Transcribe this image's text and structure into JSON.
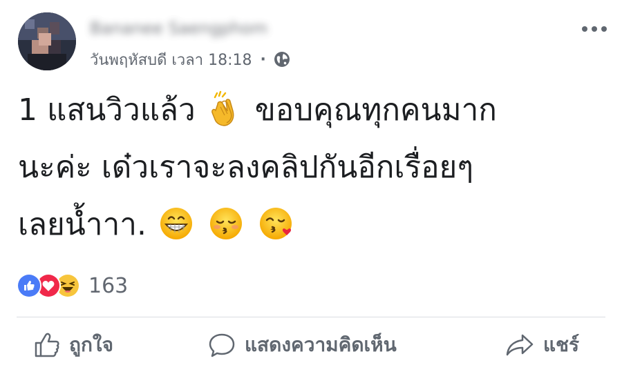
{
  "post": {
    "author_name": "Bananee Saengphom",
    "timestamp": "วันพฤหัสบดี เวลา 18:18",
    "separator": "·",
    "privacy_icon": "globe-icon",
    "more_icon": "more-horizontal-icon",
    "text_lines": [
      {
        "before": "1 แสนวิวแล้ว",
        "emoji": "clapping-hands-emoji",
        "after": "ขอบคุณทุกคนมาก"
      },
      {
        "before": "นะค่ะ เด๋วเราจะลงคลิปกันอีกเรื่อยๆ"
      },
      {
        "before": "เลยน้ำาา.",
        "emojis": [
          "grinning-emoji",
          "kissing-closed-eyes-emoji",
          "face-blowing-kiss-emoji"
        ]
      }
    ],
    "reactions": {
      "icons": [
        "like-reaction-icon",
        "love-reaction-icon",
        "haha-reaction-icon"
      ],
      "count": "163"
    },
    "actions": {
      "like": "ถูกใจ",
      "comment": "แสดงความคิดเห็น",
      "share": "แชร์"
    }
  },
  "colors": {
    "like_blue": "#4a7bf7",
    "love_red": "#f0284a",
    "haha_yellow": "#f7c53c",
    "secondary_text": "#616770"
  }
}
